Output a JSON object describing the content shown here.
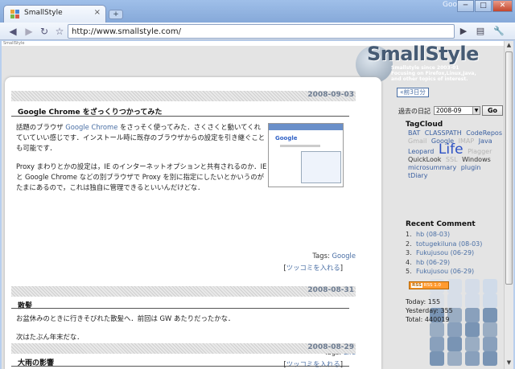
{
  "browser": {
    "tab_title": "SmallStyle",
    "tab_close": "×",
    "new_tab": "+",
    "corner_label": "Google",
    "window_buttons": {
      "minimize": "─",
      "maximize": "□",
      "close": "✕"
    },
    "address": "http://www.smallstyle.com/"
  },
  "site": {
    "small_label": "SmallStyle",
    "logo_text": "SmallStyle",
    "logo_tagline": [
      "Smallstyle since 2003-01",
      "Focusing on Firefox,Linux,Java,",
      "and other topics of interest."
    ]
  },
  "posts": [
    {
      "date": "2008-09-03",
      "title": "Google Chrome をざっくりつかってみた",
      "paragraphs": [
        {
          "pre": "話題のブラウザ ",
          "link": "Google Chrome",
          "post": " をさっそく使ってみた．さくさくと動いてくれていていい感じです．インストール時に既存のブラウザからの設定を引き継ぐことも可能です．"
        },
        {
          "pre": "Proxy まわりとかの設定は，IE のインターネットオプションと共有されるのか．IE と Google Chrome などの別ブラウザで Proxy を別に指定にしたいとかいうのがたまにあるので，これは独自に管理できるといいんだけどな．",
          "link": "",
          "post": ""
        }
      ],
      "thumbnail_label": "Google",
      "tags_label": "Tags:",
      "tag": "Google",
      "comment_link": "ツッコミを入れる"
    },
    {
      "date": "2008-08-31",
      "title": "散髪",
      "paragraphs": [
        {
          "pre": "お盆休みのときに行きそびれた散髪へ．前回は GW あたりだったかな．",
          "link": "",
          "post": ""
        },
        {
          "pre": "次はたぶん年末だな．",
          "link": "",
          "post": ""
        }
      ],
      "tags_label": "Tags:",
      "tag": "Life",
      "comment_link": "ツッコミを入れる"
    },
    {
      "date": "2008-08-29",
      "title": "大雨の影響"
    }
  ],
  "sidebar": {
    "prev_button": "«前3日分",
    "diary_label": "過去の日記",
    "diary_select": "2008-09",
    "go_button": "Go",
    "tagcloud_title": "TagCloud",
    "tagcloud": [
      {
        "text": "BAT",
        "style": "blue"
      },
      {
        "text": "CLASSPATH",
        "style": "blue"
      },
      {
        "text": "CodeRepos",
        "style": "blue"
      },
      {
        "text": "Gmail",
        "style": "light"
      },
      {
        "text": "Google",
        "style": "blue"
      },
      {
        "text": "IMAP",
        "style": "light"
      },
      {
        "text": "Java",
        "style": "blue"
      },
      {
        "text": "Leopard",
        "style": "blue"
      },
      {
        "text": "Life",
        "style": "big"
      },
      {
        "text": "Plagger",
        "style": "light"
      },
      {
        "text": "QuickLook",
        "style": "dark"
      },
      {
        "text": "SSL",
        "style": "light"
      },
      {
        "text": "Windows",
        "style": "dark"
      },
      {
        "text": "microsummary",
        "style": "blue"
      },
      {
        "text": "plugin",
        "style": "blue"
      },
      {
        "text": "tDiary",
        "style": "blue"
      }
    ],
    "recent_title": "Recent Comment",
    "recent_comments": [
      {
        "num": "1.",
        "text": "hb (08-03)"
      },
      {
        "num": "2.",
        "text": "totugekiluna (08-03)"
      },
      {
        "num": "3.",
        "text": "Fukujusou (06-29)"
      },
      {
        "num": "4.",
        "text": "hb (06-29)"
      },
      {
        "num": "5.",
        "text": "Fukujusou (06-29)"
      }
    ],
    "rss_badge": "RSS 1.0",
    "stats": {
      "today": "Today: 155",
      "yesterday": "Yesterday: 355",
      "total": "Total: 440019"
    }
  },
  "colors": {
    "accent": "#4a6fa5",
    "date_text": "#6e7d92",
    "tile_blue": "#5d7fa8"
  }
}
